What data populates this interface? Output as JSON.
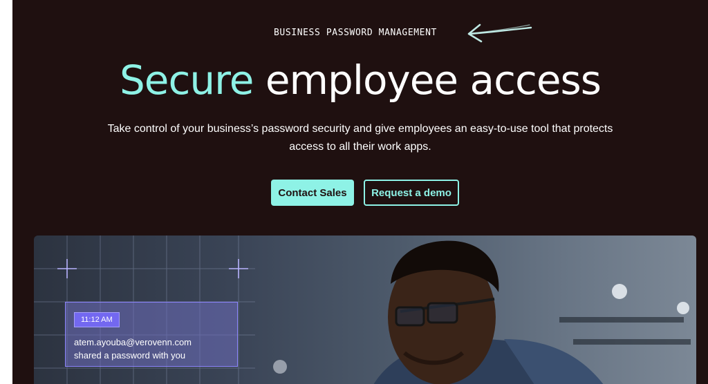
{
  "hero": {
    "eyebrow": "BUSINESS PASSWORD MANAGEMENT",
    "eyebrow_arrow_icon": "hand-drawn-arrow-icon",
    "headline_accent": "Secure",
    "headline_rest": " employee access",
    "subhead": "Take control of your business’s password security and give employees an easy-to-use tool that protects access to all their work apps.",
    "buttons": {
      "primary_label": "Contact Sales",
      "secondary_label": "Request a demo"
    }
  },
  "notification": {
    "time": "11:12 AM",
    "line1": "atem.ayouba@verovenn.com",
    "line2": "shared a password with you"
  },
  "colors": {
    "background": "#1f1010",
    "accent": "#8ef2e6",
    "notification_accent": "#7368f0"
  }
}
